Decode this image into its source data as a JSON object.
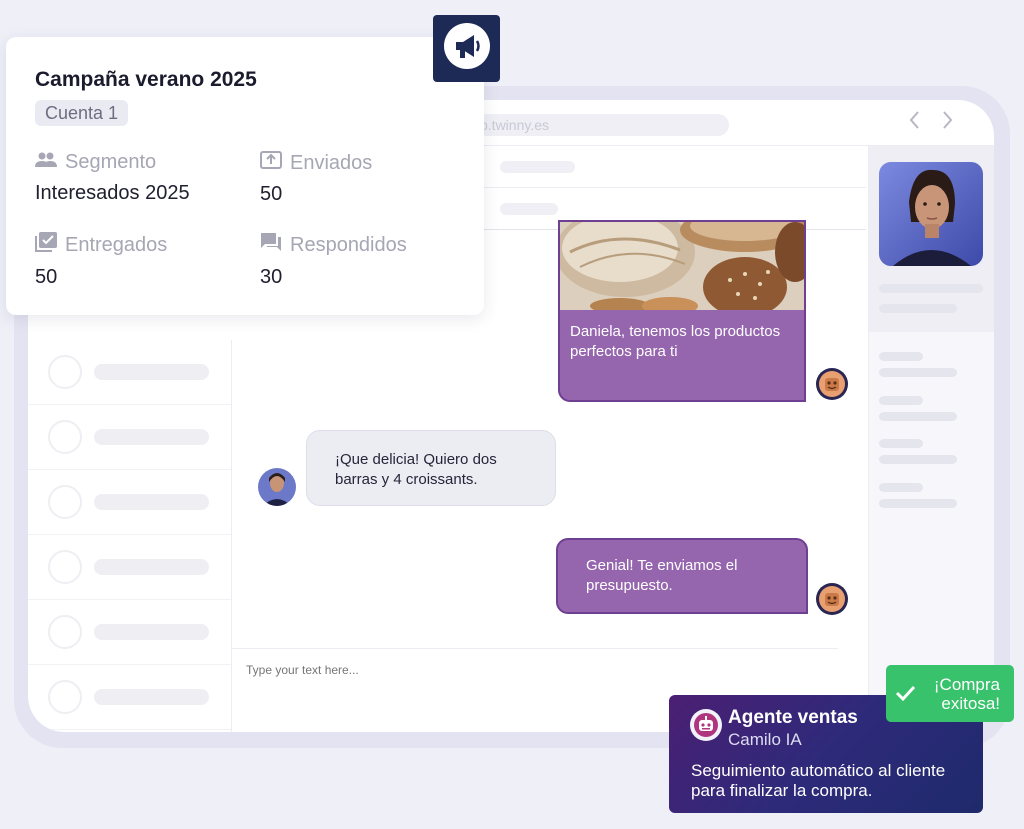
{
  "campaign": {
    "title": "Campaña verano 2025",
    "account": "Cuenta 1",
    "stats": [
      {
        "label": "Segmento",
        "value": "Interesados 2025",
        "icon": "people-icon"
      },
      {
        "label": "Enviados",
        "value": "50",
        "icon": "upload-icon"
      },
      {
        "label": "Entregados",
        "value": "50",
        "icon": "check-box-icon"
      },
      {
        "label": "Respondidos",
        "value": "30",
        "icon": "chat-bubble-icon"
      }
    ]
  },
  "browser": {
    "url": "p.twinny.es",
    "back_icon": "chevron-left-icon",
    "forward_icon": "chevron-right-icon"
  },
  "chat": {
    "messages": [
      {
        "sender": "agent",
        "text": "Daniela, tenemos los productos perfectos para ti",
        "has_image": true
      },
      {
        "sender": "customer",
        "text": "¡Que delicia! Quiero dos barras y 4 croissants."
      },
      {
        "sender": "agent",
        "text": "Genial! Te enviamos el presupuesto."
      }
    ],
    "input_placeholder": "Type your text here..."
  },
  "agent_card": {
    "name": "Agente ventas",
    "subtitle": "Camilo IA",
    "description": "Seguimiento automático al cliente para finalizar la compra."
  },
  "success_badge": {
    "text": "¡Compra exitosa!"
  },
  "colors": {
    "agent_bubble": "#9565ad",
    "badge_navy": "#1d2a55",
    "success_green": "#37c26b"
  }
}
